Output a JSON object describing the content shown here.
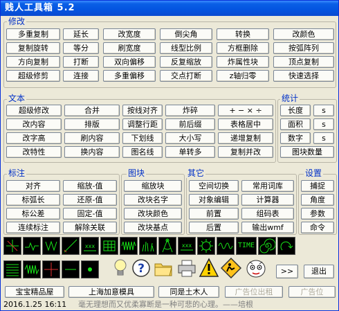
{
  "title": "贱人工具箱 5.2",
  "groups": {
    "modify": "修改",
    "text": "文本",
    "stats": "统计",
    "dim": "标注",
    "block": "图块",
    "other": "其它",
    "settings": "设置"
  },
  "modify_buttons": [
    [
      "多重复制",
      "延长",
      "改宽度",
      "倒尖角",
      "转换",
      "改颜色"
    ],
    [
      "复制旋转",
      "等分",
      "刷宽度",
      "线型比例",
      "方框删除",
      "按弧阵列"
    ],
    [
      "方向复制",
      "打断",
      "双向偏移",
      "反复缩放",
      "炸属性块",
      "顶点复制"
    ],
    [
      "超级修剪",
      "连接",
      "多重偏移",
      "交点打断",
      "z轴归零",
      "快速选择"
    ]
  ],
  "text_buttons": [
    [
      "超级修改",
      "合并",
      "按线对齐",
      "炸碎",
      "+ − × ÷"
    ],
    [
      "改内容",
      "排版",
      "调整行距",
      "前后缀",
      "表格居中"
    ],
    [
      "改字高",
      "刷内容",
      "下划线",
      "大小写",
      "递增复制"
    ],
    [
      "改特性",
      "换内容",
      "图名线",
      "单转多",
      "复制并改"
    ]
  ],
  "stats_buttons": [
    [
      "长度",
      "s"
    ],
    [
      "面积",
      "s"
    ],
    [
      "数字",
      "s"
    ],
    [
      "图块数量"
    ]
  ],
  "dim_buttons": [
    [
      "对齐",
      "缩放-值"
    ],
    [
      "标弧长",
      "还原-值"
    ],
    [
      "标公差",
      "固定-值"
    ],
    [
      "连续标注",
      "解除关联"
    ]
  ],
  "block_buttons": [
    "缩放块",
    "改块名字",
    "改块颜色",
    "改块基点"
  ],
  "other_buttons": [
    [
      "空间切换",
      "常用词库"
    ],
    [
      "对象编辑",
      "计算器"
    ],
    [
      "前置",
      "组码表"
    ],
    [
      "后置",
      "输出wmf"
    ]
  ],
  "settings_buttons": [
    "捕捉",
    "角度",
    "参数",
    "命令"
  ],
  "icon_row1": [
    "cross-axis-icon",
    "zigzag-line-icon",
    "vertical-chevrons-icon",
    "diagonal-line-icon",
    "hatch-arrows-icon",
    "grid-table-icon",
    "wave-pattern-icon",
    "grass-icon",
    "compass-icon",
    "xxx-pattern-icon",
    "gear-outline-icon",
    "sine-wave-icon",
    "time-icon",
    "spiral-icon",
    "curl-arrow-icon"
  ],
  "icon_row2": [
    "horizontal-stripes-icon",
    "spring-coil-icon",
    "crosshair-icon",
    "short-line-icon",
    "dot-icon"
  ],
  "time_label": "TIME",
  "more_label": ">>",
  "exit_label": "退出",
  "bottom_buttons": [
    "宝宝精品屋",
    "上海加意模具",
    "同是土木人"
  ],
  "ad_buttons": [
    "广告位出租",
    "广告位"
  ],
  "status": {
    "datetime": "2016.1.25  16:11",
    "quote": "毫无理想而又优柔寡断是一种可悲的心理。——培根"
  }
}
